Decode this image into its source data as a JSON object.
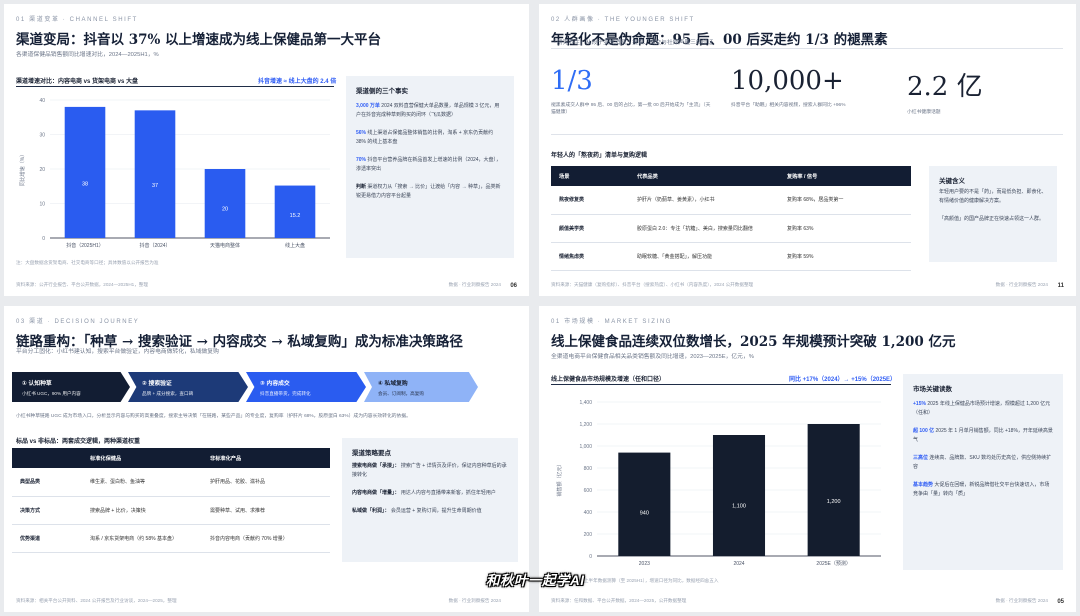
{
  "slide1": {
    "kicker": "01  渠道变革  ·  CHANNEL SHIFT",
    "title": "渠道变局：抖音以 37% 以上增速成为线上保健品第一大平台",
    "subtitle": "各渠道保健品销售额同比增速对比，2024—2025H1，%",
    "chart_head": "渠道增速对比：内容电商 vs 货架电商 vs 大盘",
    "chart_tag": "抖音增速 ≈ 线上大盘的 2.4 倍",
    "note": "注：大盘数据含货架电商、社交电商等口径；具体数值以公开报告为准",
    "footer": "资料来源：公开行业报告、平台公开数据，2024—2025H1，整理",
    "footer_right": "数据 · 行业洞察报告 2024",
    "page": "06",
    "sidepanel": {
      "title": "渠道侧的三个事实",
      "items": [
        {
          "hl": "3,000 万单",
          "text": " 2024 双料直营保健大单品数量，单品规模 3 亿元，用户在抖音完成种草到购买的闭环（飞瓜数据）"
        },
        {
          "hl": "56%",
          "text": " 线上渠道占保健品整体销售的比例，淘系 + 京东仍贡献约 38% 的线上基本盘"
        },
        {
          "hl": "70%",
          "text": " 抖音平台营养品牌在新品首发上增速的比例（2024，大盘），渗透率突出"
        },
        {
          "hl": "判断",
          "text": " 渠道权力从「搜索 → 比价」让渡给「内容 → 种草」，品类新锐更易借力内容平台起量"
        }
      ]
    },
    "chart_data": {
      "type": "bar",
      "title": "",
      "ylabel": "同比增速（%）",
      "categories": [
        "抖音（2025H1）",
        "抖音（2024）",
        "天猫电商整体",
        "线上大盘"
      ],
      "values": [
        38,
        37,
        20,
        15.2
      ],
      "ylim": [
        0,
        40
      ],
      "yticks": [
        0,
        10,
        20,
        30,
        40
      ],
      "color": "#2a5cf0"
    }
  },
  "slide2": {
    "kicker": "02  人群画像  ·  THE YOUNGER SHIFT",
    "title": "年轻化不是伪命题：95 后、00 后买走约 1/3 的褪黑素",
    "subtitle": "「朋克养生」从段子变成消费：搜索、成交与社媒声量三线印证",
    "stats": [
      {
        "value": "1/3",
        "caption": "褪黑素成交人群中 95 后、00 后的占比，第一批 00 后开始成为「主流」（天猫健康）"
      },
      {
        "value": "10,000+",
        "caption": "抖音平台「助眠」相关内容视频，搜索人群同比 +96%"
      },
      {
        "value": "2.2 亿",
        "caption": "小红书健康话题"
      }
    ],
    "section_title": "年轻人的「熬夜药」清单与复购逻辑",
    "table": {
      "headers": [
        "场景",
        "代表品类",
        "复购率 / 信号"
      ],
      "rows": [
        [
          "熬夜修复类",
          "护肝片（奶蓟草、姜黄素），小红书",
          "复购率 68%，居品类第一"
        ],
        [
          "颜值美学类",
          "胶原蛋白 2.0：专注「抗糖」、美白，搜索量同比翻倍",
          "复购率 63%"
        ],
        [
          "情绪焦虑类",
          "助眠软糖、「黄金搭配」，解压功能",
          "复购率 59%"
        ]
      ]
    },
    "sidepanel": {
      "title": "关键含义",
      "items": [
        {
          "text": "年轻用户要的不是「药」，而是低负担、即食化、有情绪价值的健康解决方案。"
        },
        {
          "text": "「高颜值」的国产品牌正在快速占领这一人群。"
        }
      ]
    },
    "footer": "资料来源：天猫健康（复购指标）、抖音平台（搜索热度）、小红书（内容热度），2024 公开数据整理",
    "footer_right": "数据 · 行业洞察报告 2024",
    "page": "11"
  },
  "slide3": {
    "kicker": "03  渠道  ·  DECISION JOURNEY",
    "title": "链路重构：「种草 → 搜索验证 → 内容成交 → 私域复购」成为标准决策路径",
    "subtitle": "平台分工固化：小红书建认知，搜索平台做验证，内容电商做转化，私域做复购",
    "steps": [
      {
        "head": "① 认知种草",
        "desc": "小红书 UGC，90% 用户内容"
      },
      {
        "head": "② 搜索验证",
        "desc": "品牌 + 成分搜索，查口碑"
      },
      {
        "head": "③ 内容成交",
        "desc": "抖音直播带货，完成转化"
      },
      {
        "head": "④ 私域复购",
        "desc": "会员、订阅制，高复购"
      }
    ],
    "body_note": "小红书种草链路 UGC 成为市场入口，分析显示内容与购买的高重叠度，搜索主导决策「在链路，某些产品」的专业度，复购率（护肝片 68%，胶原蛋白 63%）成为内容长效转化的依据。",
    "section_title": "标品 vs 非标品：两套成交逻辑，两种渠道权重",
    "table": {
      "headers": [
        "",
        "标准化保健品",
        "非标准化产品"
      ],
      "rows": [
        [
          "典型品类",
          "维生素、蛋白粉、鱼油等",
          "护肝用品、花胶、滋补品"
        ],
        [
          "决策方式",
          "搜索品牌 + 比价，决策快",
          "需要种草、试用、求推荐"
        ],
        [
          "优势渠道",
          "淘系 / 京东货架电商（约 58% 基本盘）",
          "抖音内容电商（贡献约 70% 增量）"
        ]
      ]
    },
    "sidepanel": {
      "title": "渠道策略要点",
      "items": [
        {
          "k": "搜索电商做「承接」：",
          "text": " 搜索广告 + 详情页及评价，保证内容种草后的承接转化"
        },
        {
          "k": "内容电商做「增量」：",
          "text": " 用达人内容与直播带来新客，抓住年轻用户"
        },
        {
          "k": "私域做「利润」：",
          "text": " 会员运营 + 复购订阅，提升生命周期价值"
        }
      ]
    },
    "footer": "资料来源：相关平台公开资料、2024 公开报告及行业访谈，2024—2025，整理",
    "footer_right": "数据 · 行业洞察报告 2024",
    "page": ""
  },
  "slide4": {
    "kicker": "01  市场规模  ·  MARKET SIZING",
    "title": "线上保健食品连续双位数增长，2025 年规模预计突破 1,200 亿元",
    "subtitle": "全渠道电商平台保健食品相关品类销售额及同比增速，2023—2025E，亿元，%",
    "chart_head": "线上保健食品市场规模及增速（任和口径）",
    "chart_tag": "同比 +17%（2024）→ +15%（2025E）",
    "note": "注：2025E 依据上半年数据测算（至 2025H1），增速口径为同比，数据经四舍五入",
    "sidepanel": {
      "title": "市场关键读数",
      "items": [
        {
          "hl": "+15%",
          "text": " 2025 年线上保健品市场预计增速，规模超过 1,200 亿元（任和）"
        },
        {
          "hl": "超 100 亿",
          "text": " 2025 年 1 月单月销售额，同比 +18%，开年延续高景气"
        },
        {
          "hl": "三高位",
          "text": " 连续高、品牌数、SKU 数均处历史高位，供应侧持续扩容"
        },
        {
          "hl": "基本趋势",
          "text": " 大促后在回暖，新锐品牌借社交平台快速切入，市场竞争由「量」转向「质」"
        }
      ]
    },
    "chart_data": {
      "type": "bar",
      "title": "",
      "ylabel": "销售额（亿元）",
      "categories": [
        "2023",
        "2024",
        "2025E（预测）"
      ],
      "values": [
        940,
        1100,
        1200
      ],
      "ylim": [
        0,
        1400
      ],
      "yticks": [
        0,
        200,
        400,
        600,
        800,
        1000,
        1200,
        1400
      ],
      "color": "#141d2e"
    },
    "footer": "资料来源：任和数据、平台公开数据，2024—2025，公开数据整理",
    "footer_right": "数据 · 行业洞察报告 2024",
    "page": "05"
  },
  "watermark": "和秋叶一起学AI"
}
